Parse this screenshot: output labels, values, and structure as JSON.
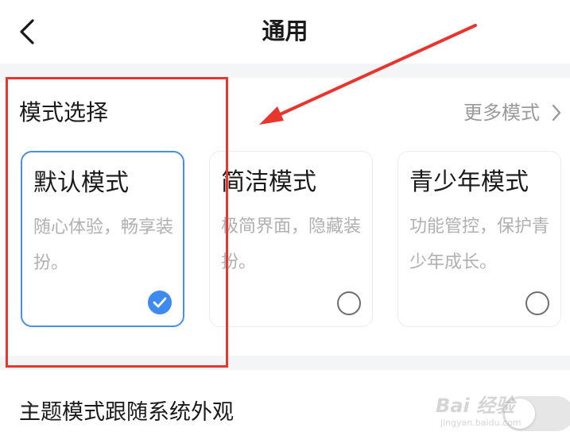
{
  "header": {
    "title": "通用",
    "back_icon": "chevron-left-icon"
  },
  "mode_selection": {
    "section_title": "模式选择",
    "more_label": "更多模式",
    "more_icon": "chevron-right-icon",
    "cards": [
      {
        "title": "默认模式",
        "description": "随心体验，畅享装扮。",
        "selected": true
      },
      {
        "title": "简洁模式",
        "description": "极简界面，隐藏装扮。",
        "selected": false
      },
      {
        "title": "青少年模式",
        "description": "功能管控，保护青少年成长。",
        "selected": false
      }
    ]
  },
  "theme_follow": {
    "label": "主题模式跟随系统外观",
    "toggle_on": false
  },
  "colors": {
    "accent": "#3d8bf0",
    "selected_border": "#4a90e2",
    "annotation": "#e8352e",
    "section_background": "#f4f5f7"
  },
  "watermark": {
    "main": "Bai 经验",
    "sub": "jingyan.baidu.com"
  }
}
